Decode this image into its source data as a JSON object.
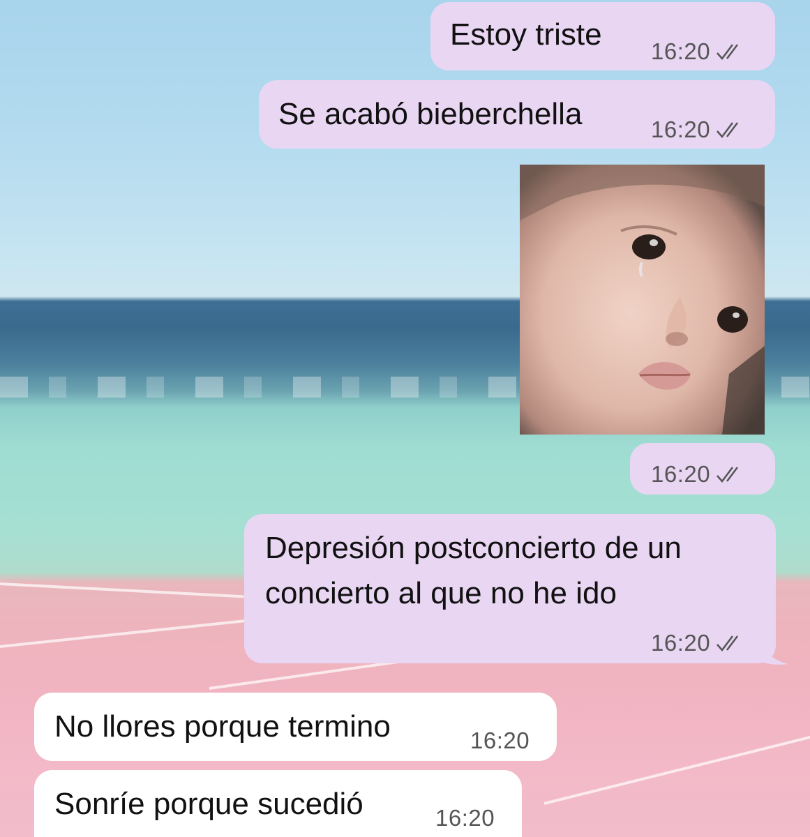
{
  "messages": [
    {
      "id": "m1",
      "direction": "outgoing",
      "text": "Estoy triste",
      "time": "16:20",
      "status": "read"
    },
    {
      "id": "m2",
      "direction": "outgoing",
      "text": "Se acabó bieberchella",
      "time": "16:20",
      "status": "read"
    },
    {
      "id": "m3",
      "direction": "outgoing",
      "type": "image",
      "image_description": "crying-baby-photo",
      "time": "16:20",
      "status": "read"
    },
    {
      "id": "m4",
      "direction": "outgoing",
      "text_lines": [
        "Depresión postconcierto de un",
        "concierto al que no he ido"
      ],
      "time": "16:20",
      "status": "read"
    },
    {
      "id": "m5",
      "direction": "incoming",
      "text": "No llores porque termino",
      "time": "16:20"
    },
    {
      "id": "m6",
      "direction": "incoming",
      "text": "Sonríe porque sucedió",
      "time": "16:20"
    }
  ],
  "colors": {
    "outgoing_bubble": "#e9d6f3",
    "incoming_bubble": "#ffffff",
    "text": "#111111",
    "timestamp": "#555555"
  },
  "icons": {
    "read_receipt": "double-check-icon"
  }
}
